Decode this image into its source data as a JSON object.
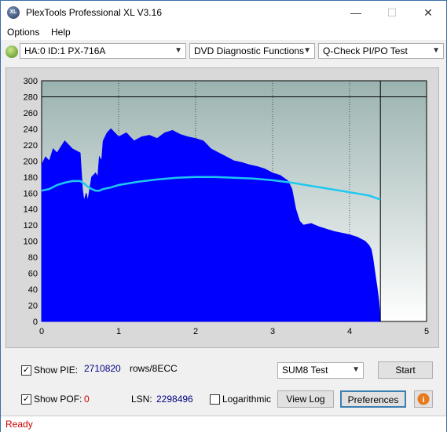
{
  "window": {
    "title": "PlexTools Professional XL V3.16",
    "icon_text": "XL"
  },
  "menu": {
    "options": "Options",
    "help": "Help"
  },
  "toolbar": {
    "drive": "HA:0 ID:1  PX-716A",
    "function": "DVD Diagnostic Functions",
    "test": "Q-Check PI/PO Test"
  },
  "chart_data": {
    "type": "area",
    "title": "",
    "xlabel": "",
    "ylabel": "",
    "xlim": [
      0,
      5
    ],
    "ylim": [
      0,
      300
    ],
    "x_ticks": [
      "0",
      "1",
      "2",
      "3",
      "4",
      "5"
    ],
    "y_ticks": [
      "0",
      "20",
      "40",
      "60",
      "80",
      "100",
      "120",
      "140",
      "160",
      "180",
      "200",
      "220",
      "240",
      "260",
      "280",
      "300"
    ],
    "reference_line_y": 280,
    "end_marker_x": 4.4,
    "grid": true,
    "series": [
      {
        "color": "#0000ff",
        "x": [
          0,
          0.05,
          0.1,
          0.15,
          0.2,
          0.3,
          0.4,
          0.5,
          0.53,
          0.55,
          0.58,
          0.6,
          0.65,
          0.7,
          0.73,
          0.75,
          0.78,
          0.8,
          0.85,
          0.9,
          1.0,
          1.1,
          1.2,
          1.3,
          1.4,
          1.5,
          1.6,
          1.7,
          1.8,
          1.9,
          2.0,
          2.1,
          2.2,
          2.3,
          2.4,
          2.5,
          2.6,
          2.7,
          2.8,
          2.9,
          3.0,
          3.1,
          3.2,
          3.25,
          3.3,
          3.35,
          3.4,
          3.5,
          3.6,
          3.7,
          3.8,
          3.9,
          4.0,
          4.1,
          4.2,
          4.25,
          4.28,
          4.3,
          4.33,
          4.36,
          4.38,
          4.4
        ],
        "values": [
          195,
          205,
          200,
          215,
          210,
          225,
          215,
          210,
          165,
          150,
          160,
          150,
          180,
          185,
          180,
          205,
          200,
          225,
          235,
          240,
          230,
          235,
          225,
          230,
          232,
          228,
          235,
          238,
          233,
          230,
          228,
          225,
          215,
          210,
          205,
          200,
          198,
          195,
          193,
          190,
          185,
          182,
          175,
          165,
          140,
          125,
          120,
          122,
          118,
          115,
          112,
          110,
          108,
          105,
          100,
          95,
          90,
          80,
          60,
          40,
          25,
          0
        ]
      },
      {
        "color": "#1ec8f0",
        "x": [
          0,
          0.1,
          0.2,
          0.3,
          0.4,
          0.5,
          0.55,
          0.6,
          0.65,
          0.7,
          0.75,
          0.8,
          0.9,
          1.0,
          1.25,
          1.5,
          1.75,
          2.0,
          2.25,
          2.5,
          2.75,
          3.0,
          3.25,
          3.5,
          3.75,
          4.0,
          4.25,
          4.4
        ],
        "values": [
          163,
          165,
          170,
          173,
          175,
          175,
          172,
          168,
          165,
          163,
          163,
          165,
          167,
          170,
          174,
          177,
          179,
          180,
          180,
          179,
          178,
          176,
          173,
          169,
          165,
          161,
          157,
          152
        ]
      }
    ]
  },
  "bottom": {
    "show_pie_label": "Show PIE:",
    "pie_value": "2710820",
    "pie_unit": "rows/8ECC",
    "show_pof_label": "Show POF:",
    "pof_value": "0",
    "lsn_label": "LSN:",
    "lsn_value": "2298496",
    "logarithmic_label": "Logarithmic",
    "sum_select": "SUM8 Test",
    "start_button": "Start",
    "view_log_button": "View Log",
    "preferences_button": "Preferences"
  },
  "status": {
    "text": "Ready"
  },
  "colors": {
    "accent": "#0000ff",
    "line": "#1ec8f0",
    "status_text": "#cc0000",
    "pof_value": "#cc0000"
  }
}
